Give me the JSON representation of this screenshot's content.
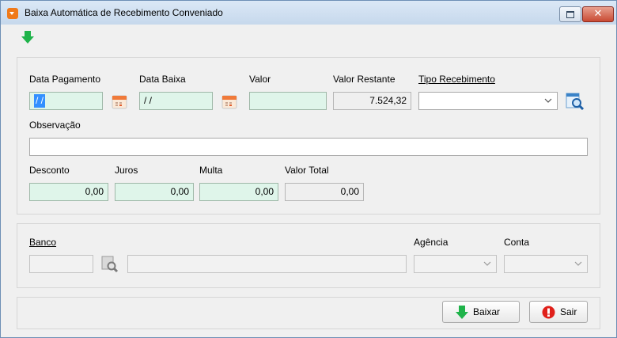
{
  "window": {
    "title": "Baixa Automática de Recebimento Conveniado",
    "close_glyph": "✕"
  },
  "icons": {
    "app": "app-icon",
    "down_arrow": "green-down-arrow-icon",
    "calendar": "calendar-icon",
    "search": "search-icon",
    "stop": "stop-icon"
  },
  "colors": {
    "field_green": "#dff5ea",
    "arrow_green": "#1fb34a",
    "stop_red": "#e0201a"
  },
  "form": {
    "data_pagamento": {
      "label": "Data Pagamento",
      "value": "/ /"
    },
    "data_baixa": {
      "label": "Data Baixa",
      "value": "/ /"
    },
    "valor": {
      "label": "Valor",
      "value": ""
    },
    "valor_restante": {
      "label": "Valor Restante",
      "value": "7.524,32"
    },
    "tipo_recebimento": {
      "label": "Tipo Recebimento",
      "value": ""
    },
    "observacao": {
      "label": "Observação",
      "value": ""
    },
    "desconto": {
      "label": "Desconto",
      "value": "0,00"
    },
    "juros": {
      "label": "Juros",
      "value": "0,00"
    },
    "multa": {
      "label": "Multa",
      "value": "0,00"
    },
    "valor_total": {
      "label": "Valor Total",
      "value": "0,00"
    }
  },
  "bank": {
    "banco": {
      "label": "Banco",
      "code": "",
      "name": ""
    },
    "agencia": {
      "label": "Agência",
      "value": ""
    },
    "conta": {
      "label": "Conta",
      "value": ""
    }
  },
  "buttons": {
    "baixar": "Baixar",
    "sair": "Sair"
  }
}
